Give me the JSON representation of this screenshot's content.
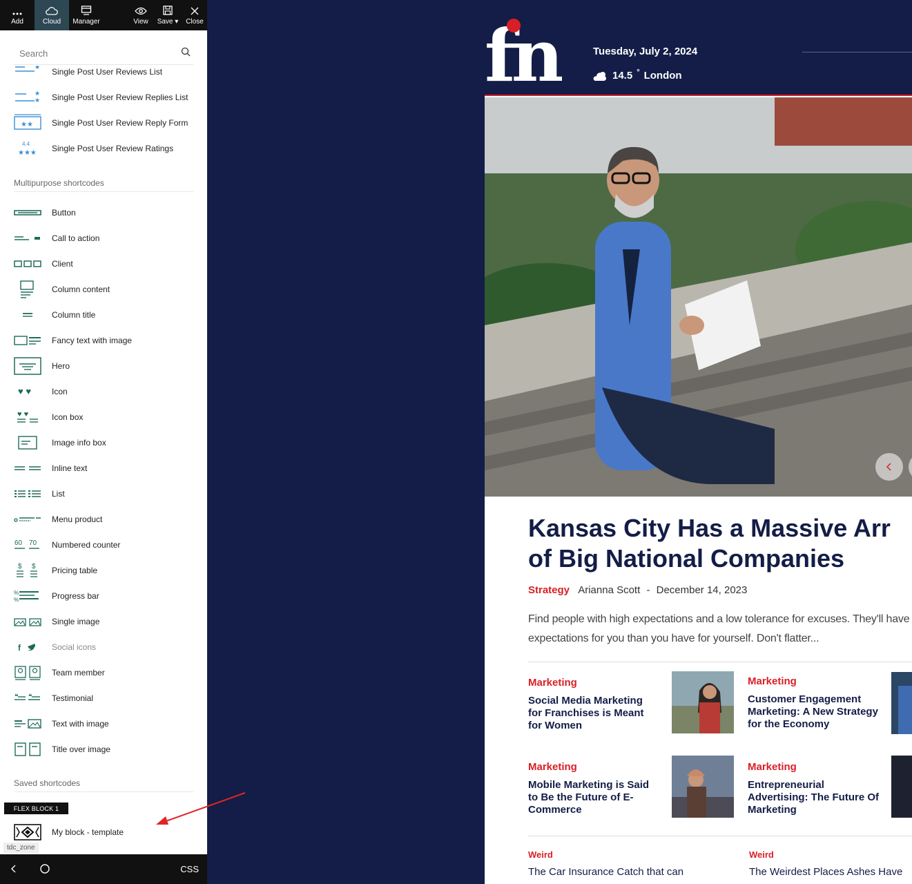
{
  "toolbar": {
    "add": "Add",
    "cloud": "Cloud",
    "manager": "Manager",
    "view": "View",
    "save": "Save",
    "close": "Close"
  },
  "search": {
    "placeholder": "Search"
  },
  "list_top": [
    {
      "label": "Single Post User Reviews List",
      "icon": "review-list-icon"
    },
    {
      "label": "Single Post User Review Replies List",
      "icon": "review-replies-icon"
    },
    {
      "label": "Single Post User Review Reply Form",
      "icon": "review-reply-form-icon"
    },
    {
      "label": "Single Post User Review Ratings",
      "icon": "review-ratings-icon"
    }
  ],
  "section_multipurpose": "Multipurpose shortcodes",
  "multipurpose": [
    {
      "label": "Button",
      "icon": "button-icon"
    },
    {
      "label": "Call to action",
      "icon": "call-to-action-icon"
    },
    {
      "label": "Client",
      "icon": "client-icon"
    },
    {
      "label": "Column content",
      "icon": "column-content-icon"
    },
    {
      "label": "Column title",
      "icon": "column-title-icon"
    },
    {
      "label": "Fancy text with image",
      "icon": "fancy-text-icon"
    },
    {
      "label": "Hero",
      "icon": "hero-icon"
    },
    {
      "label": "Icon",
      "icon": "heart-icon"
    },
    {
      "label": "Icon box",
      "icon": "icon-box-icon"
    },
    {
      "label": "Image info box",
      "icon": "image-info-box-icon"
    },
    {
      "label": "Inline text",
      "icon": "inline-text-icon"
    },
    {
      "label": "List",
      "icon": "list-icon"
    },
    {
      "label": "Menu product",
      "icon": "menu-product-icon"
    },
    {
      "label": "Numbered counter",
      "icon": "numbered-counter-icon"
    },
    {
      "label": "Pricing table",
      "icon": "pricing-table-icon"
    },
    {
      "label": "Progress bar",
      "icon": "progress-bar-icon"
    },
    {
      "label": "Single image",
      "icon": "single-image-icon"
    },
    {
      "label": "Social icons",
      "icon": "social-icons-icon"
    },
    {
      "label": "Team member",
      "icon": "team-member-icon"
    },
    {
      "label": "Testimonial",
      "icon": "testimonial-icon"
    },
    {
      "label": "Text with image",
      "icon": "text-with-image-icon"
    },
    {
      "label": "Title over image",
      "icon": "title-over-image-icon"
    }
  ],
  "section_saved": "Saved shortcodes",
  "flex_badge": "FLEX BLOCK 1",
  "saved": [
    {
      "label": "My block - template",
      "icon": "block-template-icon"
    }
  ],
  "tdc_zone": "tdc_zone",
  "bottombar": {
    "css": "CSS"
  },
  "colors": {
    "navy": "#131d47",
    "accent": "#d81f26",
    "icon_green": "#1e6b5a"
  },
  "site": {
    "logo_text": "fn",
    "date": "Tuesday, July 2, 2024",
    "temperature": "14.5",
    "temp_unit": "°",
    "city": "London"
  },
  "article": {
    "headline_line1": "Kansas City Has a Massive Arr",
    "headline_line2": "of Big National Companies",
    "category": "Strategy",
    "author": "Arianna Scott",
    "separator": "-",
    "date": "December 14, 2023",
    "excerpt_line1": "Find people with high expectations and a low tolerance for excuses. They'll have hig",
    "excerpt_line2": "expectations for you than you have for yourself. Don't flatter..."
  },
  "cards": [
    {
      "category": "Marketing",
      "title": "Social Media Marketing for Franchises is Meant for Women"
    },
    {
      "category": "Marketing",
      "title": "Customer Engagement Marketing: A New Strategy for the Economy"
    },
    {
      "category": "Marketing",
      "title": "Mobile Marketing is Said to Be the Future of E-Commerce"
    },
    {
      "category": "Marketing",
      "title": "Entrepreneurial Advertising: The Future Of Marketing"
    }
  ],
  "small_posts": [
    {
      "category": "Weird",
      "title": "The Car Insurance Catch that can"
    },
    {
      "category": "Weird",
      "title": "The Weirdest Places Ashes Have"
    }
  ]
}
